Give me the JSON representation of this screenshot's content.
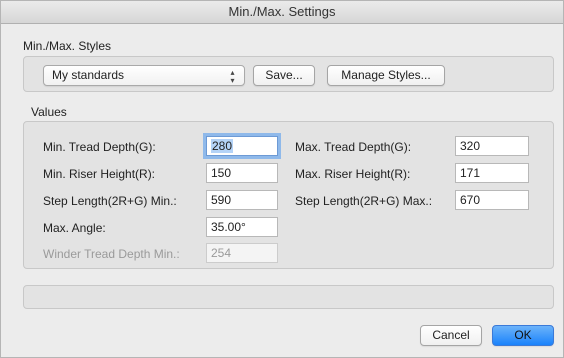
{
  "window": {
    "title": "Min./Max. Settings"
  },
  "styles": {
    "section_label": "Min./Max. Styles",
    "selected_style": "My standards",
    "save_label": "Save...",
    "manage_label": "Manage Styles..."
  },
  "values": {
    "section_label": "Values",
    "min_tread_depth": {
      "label": "Min. Tread Depth(G):",
      "value": "280"
    },
    "max_tread_depth": {
      "label": "Max. Tread Depth(G):",
      "value": "320"
    },
    "min_riser_height": {
      "label": "Min. Riser Height(R):",
      "value": "150"
    },
    "max_riser_height": {
      "label": "Max. Riser Height(R):",
      "value": "171"
    },
    "step_length_min": {
      "label": "Step Length(2R+G) Min.:",
      "value": "590"
    },
    "step_length_max": {
      "label": "Step Length(2R+G) Max.:",
      "value": "670"
    },
    "max_angle": {
      "label": "Max. Angle:",
      "value": "35.00°"
    },
    "winder_tread_depth_min": {
      "label": "Winder Tread Depth Min.:",
      "value": "254"
    }
  },
  "buttons": {
    "cancel_label": "Cancel",
    "ok_label": "OK"
  }
}
